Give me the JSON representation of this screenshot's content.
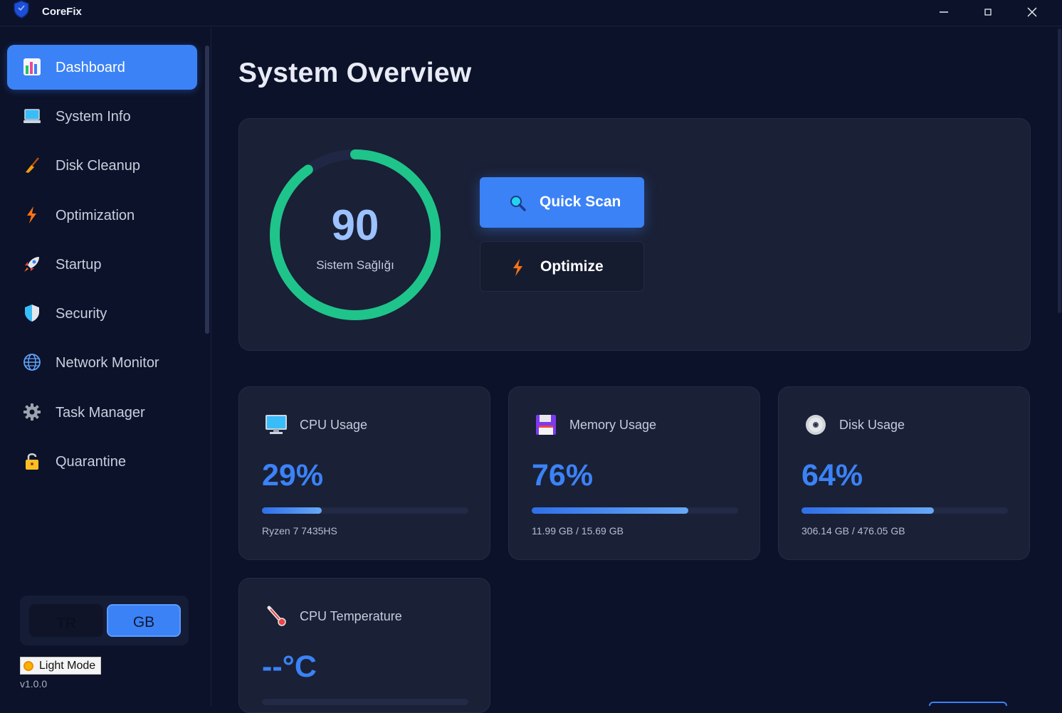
{
  "app": {
    "title": "CoreFix"
  },
  "window": {
    "minimize": "—",
    "maximize": "□",
    "close": "✕"
  },
  "sidebar": {
    "items": [
      {
        "label": "Dashboard",
        "icon": "dashboard-chart-icon",
        "active": true
      },
      {
        "label": "System Info",
        "icon": "laptop-icon"
      },
      {
        "label": "Disk Cleanup",
        "icon": "broom-icon"
      },
      {
        "label": "Optimization",
        "icon": "lightning-icon"
      },
      {
        "label": "Startup",
        "icon": "rocket-icon"
      },
      {
        "label": "Security",
        "icon": "shield-icon"
      },
      {
        "label": "Network Monitor",
        "icon": "globe-icon"
      },
      {
        "label": "Task Manager",
        "icon": "gear-icon"
      },
      {
        "label": "Quarantine",
        "icon": "lock-icon"
      }
    ],
    "languages": {
      "tr": "TR",
      "gb": "GB",
      "selected": "GB"
    },
    "theme_toggle": "Light Mode",
    "version": "v1.0.0"
  },
  "main": {
    "title": "System Overview",
    "health": {
      "score": "90",
      "label": "Sistem Sağlığı",
      "fraction": 0.9,
      "color": "#1fc48a"
    },
    "actions": {
      "quick_scan": "Quick Scan",
      "optimize": "Optimize"
    },
    "cards": [
      {
        "title": "CPU Usage",
        "value": "29%",
        "percent": 29,
        "sub": "Ryzen 7 7435HS",
        "icon": "monitor-icon"
      },
      {
        "title": "Memory Usage",
        "value": "76%",
        "percent": 76,
        "sub": "11.99 GB / 15.69 GB",
        "icon": "floppy-disk-icon"
      },
      {
        "title": "Disk Usage",
        "value": "64%",
        "percent": 64,
        "sub": "306.14 GB / 476.05 GB",
        "icon": "optical-disc-icon"
      },
      {
        "title": "CPU Temperature",
        "value": "--°C",
        "icon": "thermometer-icon"
      }
    ]
  },
  "colors": {
    "accent": "#3b82f6",
    "background": "#0c1229",
    "card": "#1a2036",
    "health": "#1fc48a"
  }
}
